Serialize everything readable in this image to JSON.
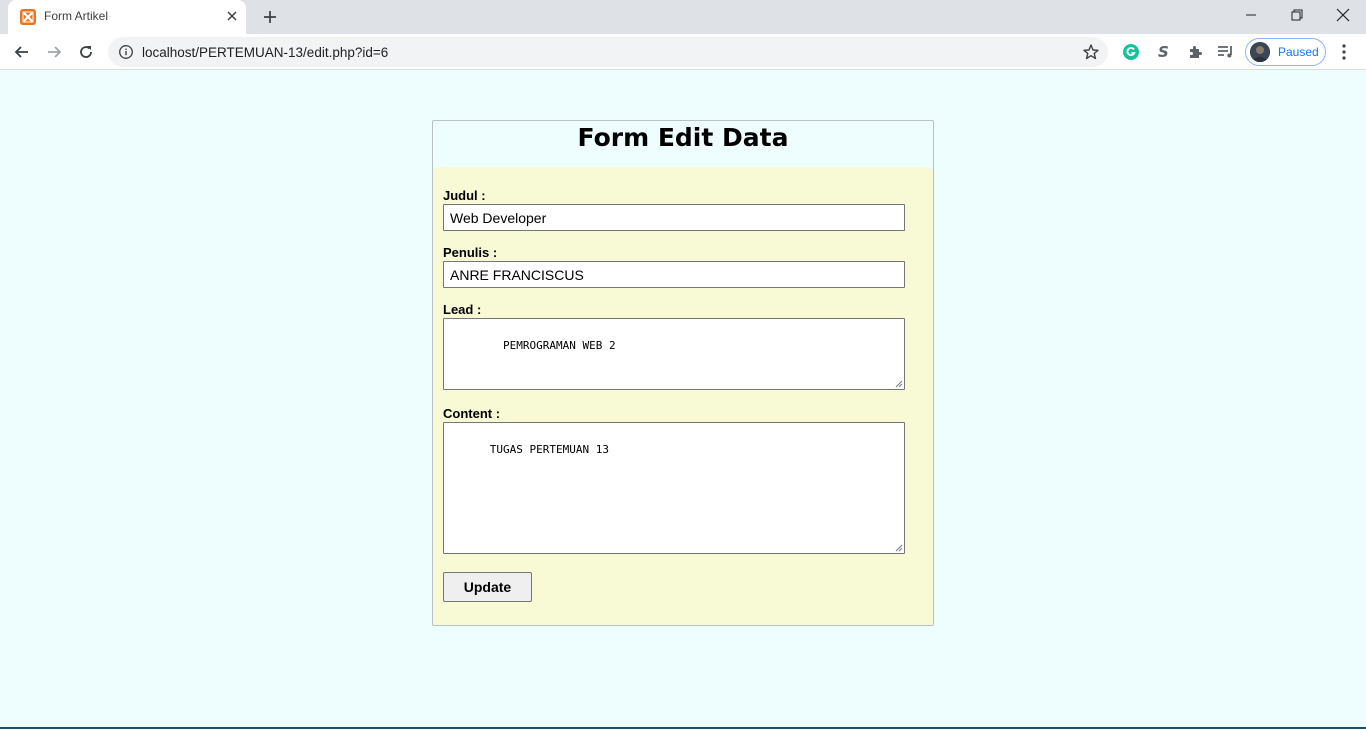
{
  "browser": {
    "tab_title": "Form Artikel",
    "url": "localhost/PERTEMUAN-13/edit.php?id=6",
    "profile_status": "Paused",
    "colors": {
      "tab_favicon": "#e8741e",
      "grammarly": "#15c39a",
      "profile_accent": "#1a73e8"
    },
    "icons": {
      "favicon": "xampp-icon",
      "close": "close-icon",
      "new_tab": "plus-icon",
      "minimize": "minimize-icon",
      "restore": "restore-icon",
      "window_close": "close-icon",
      "back": "arrow-left-icon",
      "forward": "arrow-right-icon",
      "reload": "reload-icon",
      "info": "info-icon",
      "bookmark": "star-icon",
      "grammarly": "grammarly-icon",
      "s_extension": "s-extension-icon",
      "extensions": "puzzle-icon",
      "media": "media-queue-icon",
      "menu": "kebab-menu-icon"
    }
  },
  "page": {
    "title": "Form Edit Data",
    "fields": {
      "judul": {
        "label": "Judul :",
        "value": "Web Developer"
      },
      "penulis": {
        "label": "Penulis :",
        "value": "ANRE FRANCISCUS"
      },
      "lead": {
        "label": "Lead :",
        "value": "  PEMROGRAMAN WEB 2"
      },
      "content": {
        "label": "Content :",
        "value": "TUGAS PERTEMUAN 13"
      }
    },
    "submit_label": "Update",
    "colors": {
      "page_bg": "#eefdfd",
      "form_bg": "#f8f9d5"
    }
  }
}
